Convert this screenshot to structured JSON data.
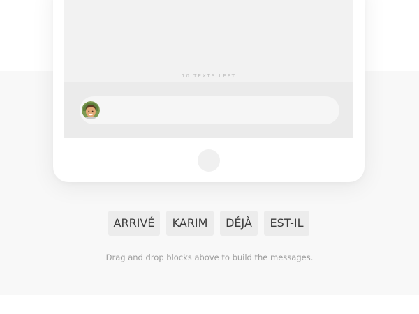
{
  "chat": {
    "counter_text": "10 TEXTS LEFT",
    "message_value": ""
  },
  "word_blocks": [
    {
      "label": "ARRIVÉ"
    },
    {
      "label": "KARIM"
    },
    {
      "label": "DÉJÀ"
    },
    {
      "label": "EST-IL"
    }
  ],
  "instructions": "Drag and drop blocks above to build the messages.",
  "colors": {
    "band_background": "#f8f8f8",
    "screen_background": "#f2f2f2",
    "input_bar_background": "#ebebeb",
    "block_background": "#ececec",
    "block_text": "#3c3c3c",
    "hint_text": "#9d9d9d"
  }
}
